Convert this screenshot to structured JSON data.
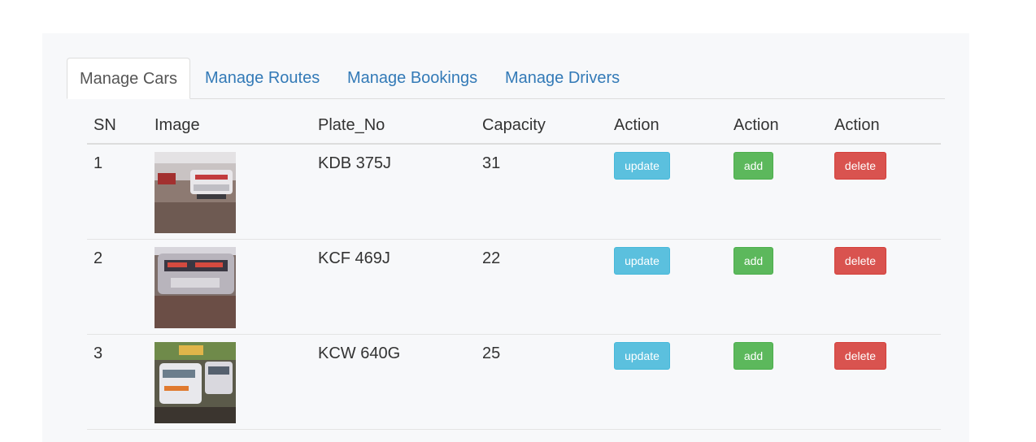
{
  "tabs": [
    {
      "label": "Manage Cars",
      "active": true
    },
    {
      "label": "Manage Routes",
      "active": false
    },
    {
      "label": "Manage Bookings",
      "active": false
    },
    {
      "label": "Manage Drivers",
      "active": false
    }
  ],
  "table": {
    "headers": [
      "SN",
      "Image",
      "Plate_No",
      "Capacity",
      "Action",
      "Action",
      "Action"
    ],
    "rows": [
      {
        "sn": "1",
        "plate": "KDB 375J",
        "capacity": "31",
        "update": "update",
        "add": "add",
        "delete": "delete"
      },
      {
        "sn": "2",
        "plate": "KCF 469J",
        "capacity": "22",
        "update": "update",
        "add": "add",
        "delete": "delete"
      },
      {
        "sn": "3",
        "plate": "KCW 640G",
        "capacity": "25",
        "update": "update",
        "add": "add",
        "delete": "delete"
      }
    ]
  },
  "colors": {
    "info": "#5bc0de",
    "success": "#5cb85c",
    "danger": "#d9534f",
    "link": "#337ab7"
  }
}
